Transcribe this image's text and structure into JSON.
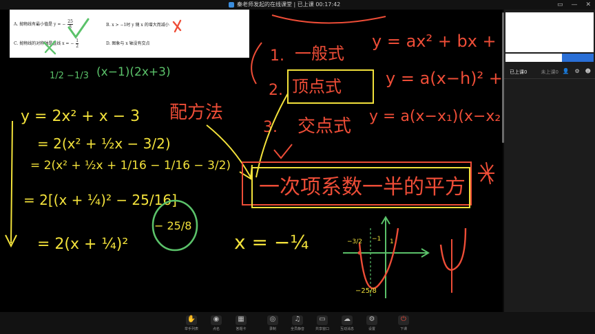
{
  "window": {
    "title": "秦老师发起的在线课堂 | 已上课 00:17:42",
    "controls": [
      "▭",
      "—",
      "✕"
    ]
  },
  "question": {
    "a_prefix": "A.  抛物线有最小值是 y = −",
    "a_num": "25",
    "a_den": "8",
    "b": "B.  x > −1时 y 随 x 的增大而减小",
    "c_prefix": "C.  抛物线的对称轴是直线 x = −",
    "c_num": "1",
    "c_den": "2",
    "d": "D.  图象与 x 轴没有交点"
  },
  "board": {
    "ink": {
      "red": "#ee4d37",
      "yellow": "#f3e23b",
      "green": "#5bc26a"
    },
    "factors": {
      "fracs": "1/2  −1/3",
      "text": "(x−1)(2x+3)"
    },
    "left_lines": [
      "y = 2x² + x − 3",
      "= 2(x² + ½x − 3/2)",
      "= 2(x² + ½x + 1/16 − 1/16 − 3/2)",
      "= 2[(x + ¼)² − 25/16]",
      "= 2(x + ¼)²"
    ],
    "circled": "− 25/8",
    "method": "配方法",
    "forms": [
      {
        "num": "1.",
        "name": "一般式",
        "eq": "y = ax² + bx + c"
      },
      {
        "num": "2.",
        "name": "顶点式",
        "eq": "y = a(x−h)² + k"
      },
      {
        "num": "3.",
        "name": "交点式",
        "eq": "y = a(x−x₁)(x−x₂)"
      }
    ],
    "boxed": "一次项系数一半的平方",
    "axis_eq": "x = −¼",
    "graph_labels": {
      "left": "−3/2",
      "top": "−1",
      "right": "1",
      "bottom": "−25/8"
    }
  },
  "sidebar": {
    "tabs": [
      {
        "label": "已上课0"
      },
      {
        "label": "未上课0"
      }
    ],
    "icons": [
      "person-icon",
      "settings-icon",
      "people-icon"
    ]
  },
  "toolbar": {
    "buttons": [
      {
        "label": "举手列表",
        "icon": "✋"
      },
      {
        "label": "点名",
        "icon": "◉"
      },
      {
        "label": "答题卡",
        "icon": "▦"
      },
      {
        "label": "录制",
        "icon": "◎"
      },
      {
        "label": "全员静音",
        "icon": "♫"
      },
      {
        "label": "共享窗口",
        "icon": "▭"
      },
      {
        "label": "互动消息",
        "icon": "☁"
      },
      {
        "label": "设置",
        "icon": "⚙"
      },
      {
        "label": "下课",
        "icon": "⏻"
      }
    ]
  }
}
